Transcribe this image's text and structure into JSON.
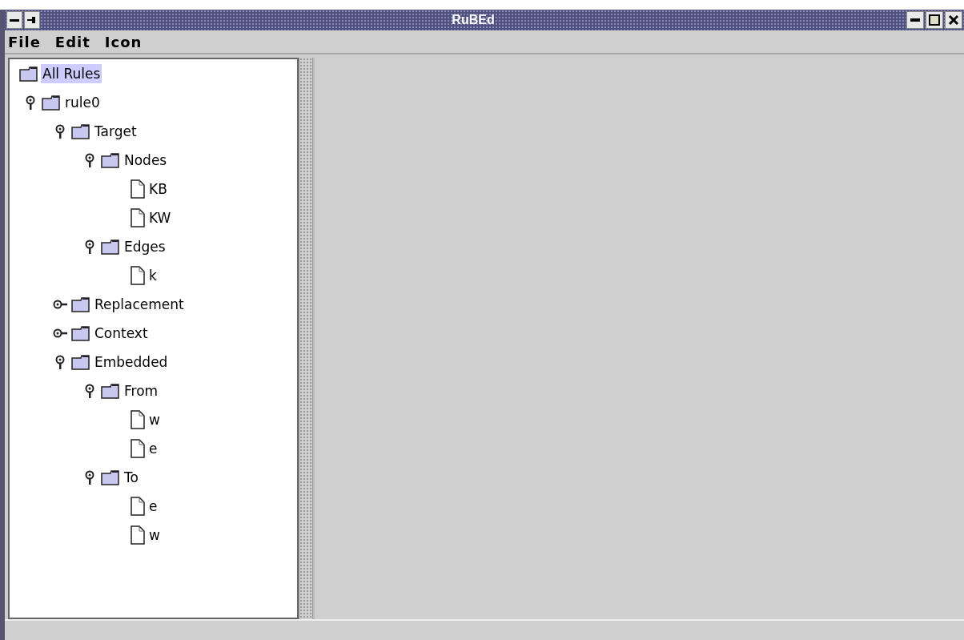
{
  "window": {
    "title": "RuBEd"
  },
  "menu": [
    "File",
    "Edit",
    "Icon"
  ],
  "tree": {
    "label": "All Rules",
    "kind": "root",
    "selected": true,
    "children": [
      {
        "label": "rule0",
        "kind": "folder",
        "expanded": true,
        "selected": false,
        "children": [
          {
            "label": "Target",
            "kind": "folder",
            "expanded": true,
            "selected": false,
            "children": [
              {
                "label": "Nodes",
                "kind": "folder",
                "expanded": true,
                "selected": false,
                "children": [
                  {
                    "label": "KB",
                    "kind": "leaf",
                    "selected": false
                  },
                  {
                    "label": "KW",
                    "kind": "leaf",
                    "selected": false
                  }
                ]
              },
              {
                "label": "Edges",
                "kind": "folder",
                "expanded": true,
                "selected": false,
                "children": [
                  {
                    "label": "k",
                    "kind": "leaf",
                    "selected": false
                  }
                ]
              }
            ]
          },
          {
            "label": "Replacement",
            "kind": "folder",
            "expanded": false,
            "selected": false
          },
          {
            "label": "Context",
            "kind": "folder",
            "expanded": false,
            "selected": false
          },
          {
            "label": "Embedded",
            "kind": "folder",
            "expanded": true,
            "selected": false,
            "children": [
              {
                "label": "From",
                "kind": "folder",
                "expanded": true,
                "selected": false,
                "children": [
                  {
                    "label": "w",
                    "kind": "leaf",
                    "selected": false
                  },
                  {
                    "label": "e",
                    "kind": "leaf",
                    "selected": false
                  }
                ]
              },
              {
                "label": "To",
                "kind": "folder",
                "expanded": true,
                "selected": false,
                "children": [
                  {
                    "label": "e",
                    "kind": "leaf",
                    "selected": false
                  },
                  {
                    "label": "w",
                    "kind": "leaf",
                    "selected": false
                  }
                ]
              }
            ]
          }
        ]
      }
    ]
  }
}
